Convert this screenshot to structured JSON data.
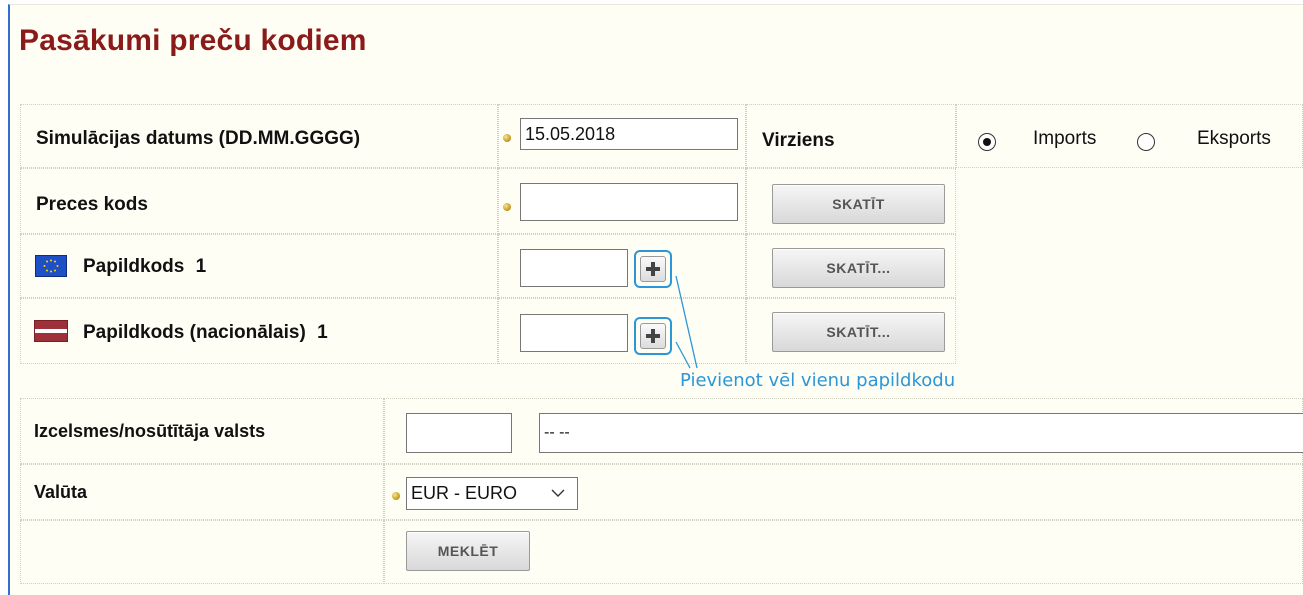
{
  "page": {
    "title": "Pasākumi preču kodiem"
  },
  "form1": {
    "simulation_date_label": "Simulācijas datums (DD.MM.GGGG)",
    "simulation_date_value": "15.05.2018",
    "direction_label": "Virziens",
    "direction_options": [
      "Imports",
      "Eksports"
    ],
    "direction_selected": "Imports",
    "goods_code_label": "Preces kods",
    "goods_code_value": "",
    "view_button": "SKATĪT",
    "additional_code_label": "Papildkods",
    "additional_code_count": "1",
    "additional_code_value": "",
    "view_more_button": "SKATĪT...",
    "national_code_label": "Papildkods (nacionālais)",
    "national_code_count": "1",
    "national_code_value": "",
    "view_more_button_2": "SKATĪT..."
  },
  "annotation": {
    "text": "Pievienot vēl vienu papildkodu",
    "color": "#2b96d8"
  },
  "form2": {
    "origin_country_label": "Izcelsmes/nosūtītāja valsts",
    "origin_country_code": "",
    "origin_country_name": "-- --",
    "currency_label": "Valūta",
    "currency_selected": "EUR - EURO",
    "search_button": "MEKLĒT"
  },
  "colors": {
    "title": "#8b1a1a",
    "background": "#fefef5",
    "left_border": "#2f6fd0"
  },
  "icons": {
    "eu_flag": "eu-flag-icon",
    "lv_flag": "latvia-flag-icon",
    "add": "plus-icon",
    "required": "required-bullet-icon",
    "dropdown": "chevron-down-icon"
  }
}
